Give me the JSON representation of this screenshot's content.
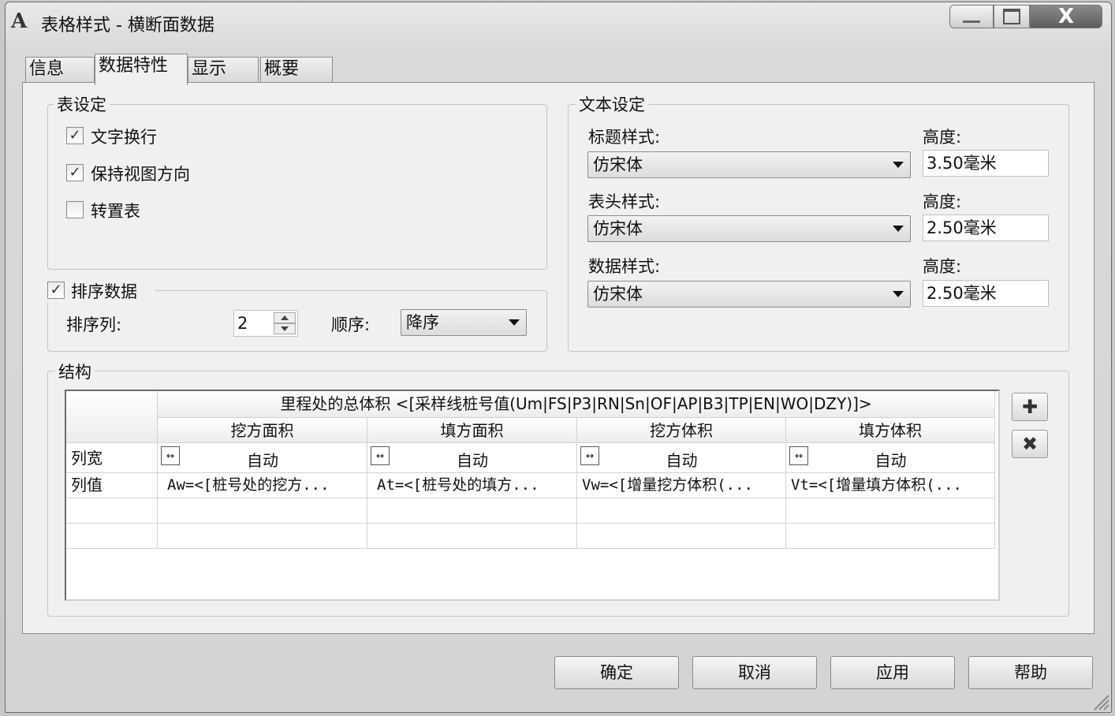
{
  "window": {
    "title": "表格样式 - 横断面数据",
    "app_icon": "A",
    "controls": {
      "close": "X"
    }
  },
  "tabs": [
    {
      "label": "信息",
      "active": false
    },
    {
      "label": "数据特性",
      "active": true
    },
    {
      "label": "显示",
      "active": false
    },
    {
      "label": "概要",
      "active": false
    }
  ],
  "table_settings": {
    "group_label": "表设定",
    "options": [
      {
        "label": "文字换行",
        "checked": true
      },
      {
        "label": "保持视图方向",
        "checked": true
      },
      {
        "label": "转置表",
        "checked": false
      }
    ]
  },
  "sort": {
    "checkbox_label": "排序数据",
    "checked": true,
    "column_label": "排序列:",
    "column_value": "2",
    "order_label": "顺序:",
    "order_value": "降序"
  },
  "text_settings": {
    "group_label": "文本设定",
    "rows": [
      {
        "label": "标题样式:",
        "style": "仿宋体",
        "height_label": "高度:",
        "height": "3.50毫米"
      },
      {
        "label": "表头样式:",
        "style": "仿宋体",
        "height_label": "高度:",
        "height": "2.50毫米"
      },
      {
        "label": "数据样式:",
        "style": "仿宋体",
        "height_label": "高度:",
        "height": "2.50毫米"
      }
    ]
  },
  "structure": {
    "group_label": "结构",
    "title_row": "里程处的总体积 <[采样线桩号值(Um|FS|P3|RN|Sn|OF|AP|B3|TP|EN|WO|DZY)]>",
    "columns": [
      "挖方面积",
      "填方面积",
      "挖方体积",
      "填方体积"
    ],
    "row_labels": {
      "width": "列宽",
      "value": "列值"
    },
    "widths": [
      "自动",
      "自动",
      "自动",
      "自动"
    ],
    "values": [
      "Aw=<[桩号处的挖方...",
      "At=<[桩号处的填方...",
      "Vw=<[增量挖方体积(...",
      "Vt=<[增量填方体积(..."
    ]
  },
  "side_buttons": {
    "add_icon": "plus-icon",
    "delete_icon": "x-icon"
  },
  "buttons": {
    "ok": "确定",
    "cancel": "取消",
    "apply": "应用",
    "help": "帮助"
  }
}
